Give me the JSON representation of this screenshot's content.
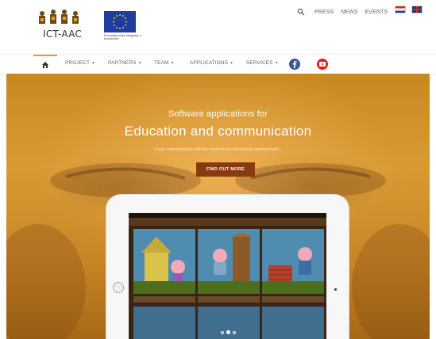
{
  "header": {
    "logo_text": "ICT-AAC",
    "eu_caption": "Europska unija Ulaganje u budućnost",
    "util_links": [
      "PRESS",
      "NEWS",
      "EVENTS"
    ],
    "search_icon": "search-icon",
    "languages": [
      "hr",
      "en"
    ]
  },
  "nav": {
    "home_icon": "home-icon",
    "items": [
      {
        "label": "PROJECT"
      },
      {
        "label": "PARTNERS"
      },
      {
        "label": "TEAM"
      },
      {
        "label": "APPLICATIONS"
      },
      {
        "label": "SERVICES"
      }
    ],
    "social": [
      "facebook-icon",
      "youtube-icon"
    ]
  },
  "hero": {
    "subtitle": "Software applications for",
    "title": "Education and communication",
    "description": "Easier communication with the environment, storytelling, learning math...",
    "button_label": "FIND OUT MORE",
    "slides": 3,
    "active_slide": 2
  },
  "colors": {
    "accent": "#e69a2a",
    "hero_overlay": "#d99a34",
    "button": "#8a3a0e",
    "facebook": "#3b5998",
    "youtube": "#e62117"
  }
}
